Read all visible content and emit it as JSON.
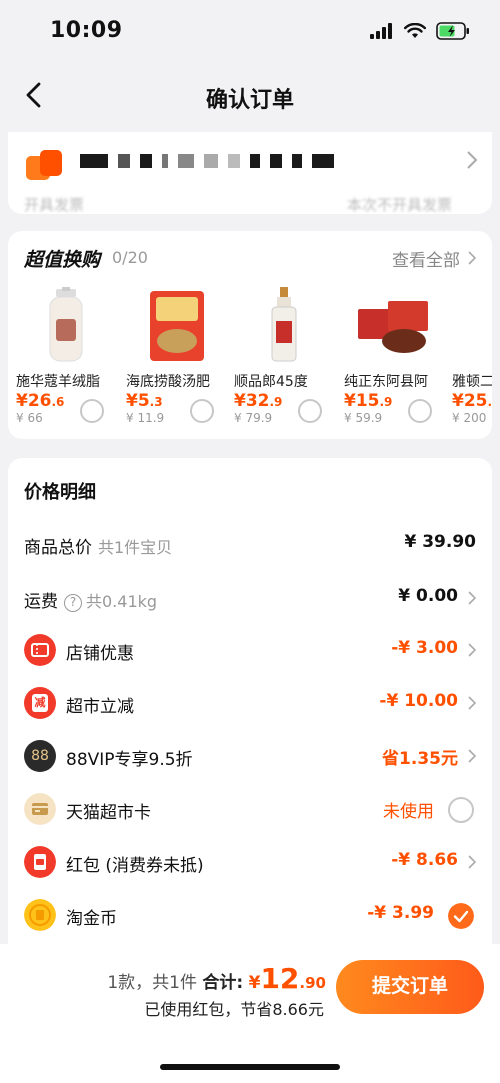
{
  "status_bar": {
    "time": "10:09"
  },
  "nav": {
    "title": "确认订单"
  },
  "address": {
    "cut_left": "开具发票",
    "cut_right": "本次不开具发票"
  },
  "deals": {
    "title": "超值换购",
    "count": "0/20",
    "view_all": "查看全部",
    "products": [
      {
        "name": "施华蔻羊绒脂",
        "price_int": "¥26",
        "price_dec": ".6",
        "old": "¥ 66"
      },
      {
        "name": "海底捞酸汤肥",
        "price_int": "¥5",
        "price_dec": ".3",
        "old": "¥ 11.9"
      },
      {
        "name": "顺品郎45度",
        "price_int": "¥32",
        "price_dec": ".9",
        "old": "¥ 79.9"
      },
      {
        "name": "纯正东阿县阿",
        "price_int": "¥15",
        "price_dec": ".9",
        "old": "¥ 59.9"
      },
      {
        "name": "雅顿二",
        "price_int": "¥25",
        "price_dec": ".",
        "old": "¥ 200"
      }
    ]
  },
  "price": {
    "title": "价格明细",
    "rows": [
      {
        "label": "商品总价",
        "sub": "共1件宝贝",
        "value": "¥ 39.90"
      },
      {
        "label": "运费",
        "sub": "共0.41kg",
        "value": "¥ 0.00"
      },
      {
        "label": "店铺优惠",
        "value": "-¥ 3.00"
      },
      {
        "label": "超市立减",
        "value": "-¥ 10.00"
      },
      {
        "label": "88VIP专享9.5折",
        "value": "省1.35元"
      },
      {
        "label": "天猫超市卡",
        "value": "未使用"
      },
      {
        "label": "红包 (消费券未抵)",
        "value": "-¥ 8.66"
      },
      {
        "label": "淘金币",
        "value": "-¥ 3.99"
      }
    ],
    "vip_badge": "88",
    "coupon_char": "减"
  },
  "bottom": {
    "count_text": "1款，共1件",
    "total_label": "合计:",
    "total_currency": "¥",
    "total_int": "12",
    "total_dec": ".90",
    "saving_text": "已使用红包，节省8.66元",
    "submit": "提交订单"
  },
  "colors": {
    "accent": "#ff5000",
    "button_start": "#ff8a1e",
    "button_end": "#ff5a1a",
    "check": "#ff6a1a"
  }
}
